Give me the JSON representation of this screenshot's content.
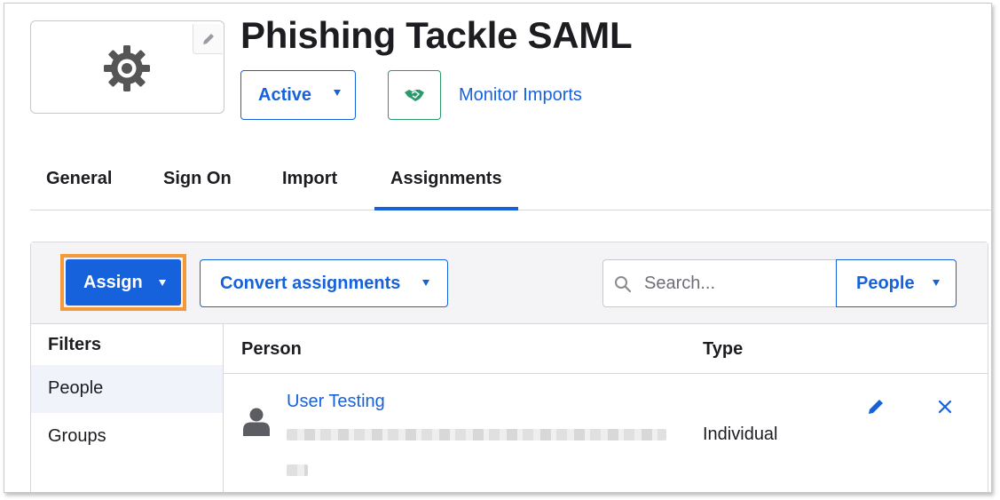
{
  "app": {
    "title": "Phishing Tackle SAML",
    "logo_icon": "gear-icon",
    "status": "Active",
    "monitor_imports": "Monitor Imports"
  },
  "tabs": [
    {
      "label": "General",
      "active": false
    },
    {
      "label": "Sign On",
      "active": false
    },
    {
      "label": "Import",
      "active": false
    },
    {
      "label": "Assignments",
      "active": true
    }
  ],
  "toolbar": {
    "assign_label": "Assign",
    "convert_label": "Convert assignments",
    "search_placeholder": "Search...",
    "search_scope": "People"
  },
  "filters": {
    "heading": "Filters",
    "items": [
      {
        "label": "People",
        "selected": true
      },
      {
        "label": "Groups",
        "selected": false
      }
    ]
  },
  "table": {
    "columns": [
      "Person",
      "Type"
    ],
    "rows": [
      {
        "name": "User  Testing",
        "type": "Individual"
      }
    ]
  },
  "colors": {
    "accent": "#1662dd",
    "highlight": "#f4983a",
    "monitor_green": "#2a9a6b"
  }
}
